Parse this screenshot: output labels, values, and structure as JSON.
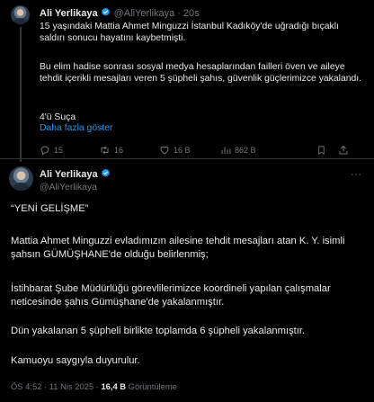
{
  "tweet1": {
    "author_name": "Ali Yerlikaya",
    "author_handle": "@AliYerlikaya",
    "separator": "·",
    "time_ago": "20s",
    "paragraphs": [
      "15 yaşındaki Mattia Ahmet Minguzzi İstanbul Kadıköy'de uğradığı bıçaklı saldırı sonucu hayatını kaybetmişti.",
      "Bu elim hadise sonrası sosyal medya hesaplarından failleri öven ve aileye tehdit içerikli mesajları veren 5 şüpheli şahıs, güvenlik güçlerimizce yakalandı.",
      "4'ü Suça"
    ],
    "show_more": "Daha fazla göster",
    "actions": {
      "replies": "15",
      "retweets": "16",
      "likes": "16 B",
      "views": "862 B"
    },
    "icons": [
      "reply-icon",
      "retweet-icon",
      "like-icon",
      "views-icon",
      "bookmark-icon",
      "share-icon"
    ]
  },
  "tweet2": {
    "author_name": "Ali Yerlikaya",
    "author_handle": "@AliYerlikaya",
    "more_icon": "···",
    "paragraphs": [
      "“YENİ GELİŞME”",
      "Mattia Ahmet Minguzzi evladımızın ailesine tehdit mesajları atan K. Y. isimli şahsın GÜMÜŞHANE'de olduğu belirlenmiş;",
      "İstihbarat Şube Müdürlüğü görevlilerimizce koordineli yapılan çalışmalar neticesinde şahıs Gümüşhane'de yakalanmıştır.",
      "Dün yakalanan 5 şüpheli birlikte toplamda 6 şüpheli yakalanmıştır.",
      "Kamuoyu saygıyla duyurulur."
    ],
    "meta": {
      "time": "ÖS 4:52",
      "dot1": "·",
      "date": "11 Nis 2025",
      "dot2": "·",
      "views_count": "16,4 B",
      "views_label": "Görüntüleme"
    }
  },
  "colors": {
    "background": "#000000",
    "text": "#e7e9ea",
    "muted": "#71767b",
    "link": "#1d9bf0",
    "verified": "#1d9bf0"
  }
}
